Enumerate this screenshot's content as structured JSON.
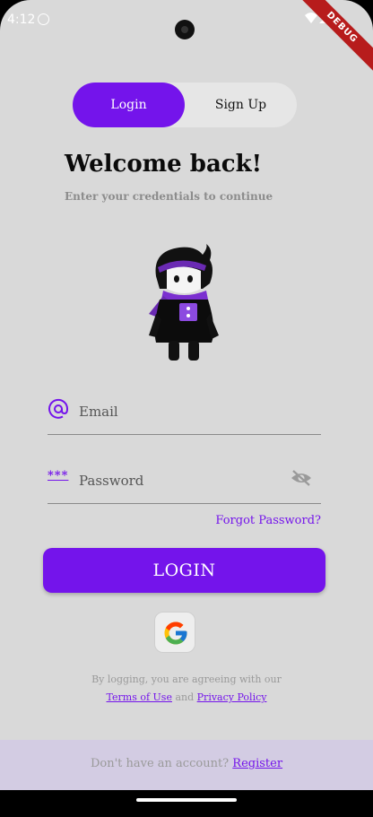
{
  "status_bar": {
    "time": "4:12",
    "debug_label": "DEBUG"
  },
  "tabs": {
    "login_label": "Login",
    "signup_label": "Sign Up"
  },
  "header": {
    "title": "Welcome back!",
    "subtitle": "Enter your credentials to continue"
  },
  "form": {
    "email_placeholder": "Email",
    "password_placeholder": "Password",
    "password_icon_text": "***",
    "forgot_label": "Forgot Password?",
    "login_button": "LOGIN"
  },
  "terms": {
    "line1": "By logging, you are agreeing with our",
    "terms_link": "Terms of Use",
    "and": "and",
    "privacy_link": "Privacy Policy"
  },
  "footer": {
    "prompt": "Don't have an account?",
    "register_link": "Register"
  },
  "colors": {
    "accent": "#7414eb",
    "background": "#d9d9d9",
    "footer": "#d3cce3"
  }
}
